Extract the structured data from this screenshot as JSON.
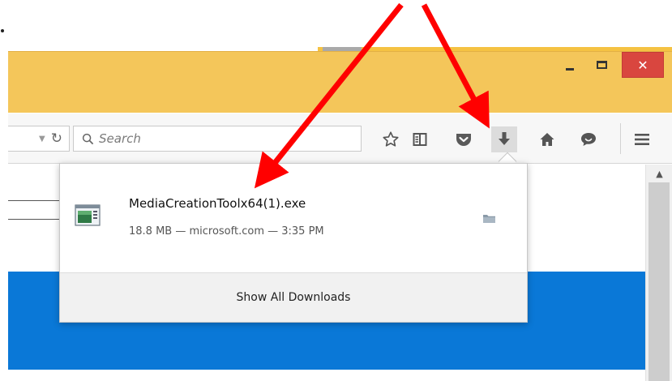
{
  "window": {
    "minimize_label": "–",
    "close_label": "✕"
  },
  "toolbar": {
    "search_placeholder": "Search",
    "icons": [
      "dropdown-icon",
      "reload-icon",
      "search-icon",
      "bookmark-star-icon",
      "reading-list-icon",
      "pocket-icon",
      "download-icon",
      "home-icon",
      "chat-icon",
      "menu-icon"
    ]
  },
  "downloads": {
    "items": [
      {
        "file_name": "MediaCreationToolx64(1).exe",
        "meta": "18.8 MB — microsoft.com — 3:35 PM"
      }
    ],
    "show_all_label": "Show All Downloads"
  },
  "colors": {
    "titlebar": "#f4c65a",
    "close_button": "#d9463f",
    "page_accent": "#0a78d7",
    "arrow": "#ff0000"
  }
}
